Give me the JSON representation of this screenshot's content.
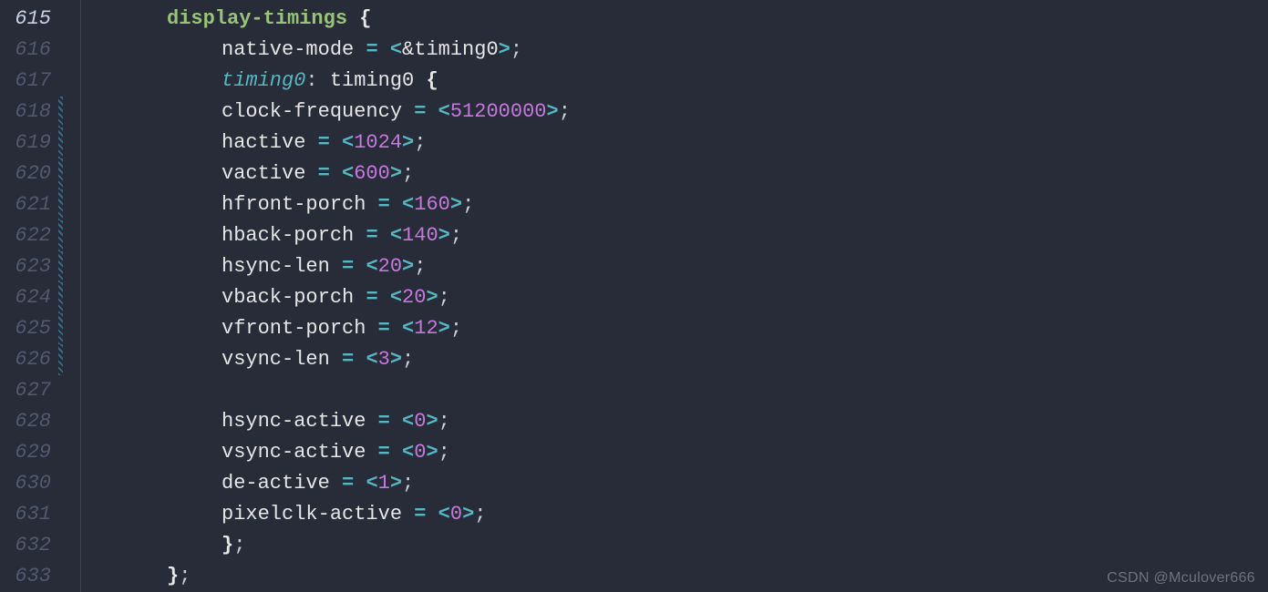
{
  "watermark": "CSDN @Mculover666",
  "gutter": {
    "start": 615,
    "active": 615,
    "modified": [
      618,
      619,
      620,
      621,
      622,
      623,
      624,
      625,
      626
    ]
  },
  "code": {
    "lines": [
      {
        "indent": 1,
        "tokens": [
          {
            "t": "display-timings",
            "c": "keyword"
          },
          {
            "t": " ",
            "c": "punct"
          },
          {
            "t": "{",
            "c": "brace"
          }
        ]
      },
      {
        "indent": 2,
        "tokens": [
          {
            "t": "native-mode",
            "c": "ident"
          },
          {
            "t": " ",
            "c": "punct"
          },
          {
            "t": "=",
            "c": "op"
          },
          {
            "t": " ",
            "c": "punct"
          },
          {
            "t": "<",
            "c": "op"
          },
          {
            "t": "&timing0",
            "c": "ref"
          },
          {
            "t": ">",
            "c": "op"
          },
          {
            "t": ";",
            "c": "punct"
          }
        ]
      },
      {
        "indent": 2,
        "tokens": [
          {
            "t": "timing0",
            "c": "label"
          },
          {
            "t": ":",
            "c": "punct"
          },
          {
            "t": " ",
            "c": "punct"
          },
          {
            "t": "timing0",
            "c": "ident"
          },
          {
            "t": " ",
            "c": "punct"
          },
          {
            "t": "{",
            "c": "brace"
          }
        ]
      },
      {
        "indent": 2,
        "tokens": [
          {
            "t": "clock-frequency",
            "c": "ident"
          },
          {
            "t": " ",
            "c": "punct"
          },
          {
            "t": "=",
            "c": "op"
          },
          {
            "t": " ",
            "c": "punct"
          },
          {
            "t": "<",
            "c": "op"
          },
          {
            "t": "51200000",
            "c": "num"
          },
          {
            "t": ">",
            "c": "op"
          },
          {
            "t": ";",
            "c": "punct"
          }
        ]
      },
      {
        "indent": 2,
        "tokens": [
          {
            "t": "hactive",
            "c": "ident"
          },
          {
            "t": " ",
            "c": "punct"
          },
          {
            "t": "=",
            "c": "op"
          },
          {
            "t": " ",
            "c": "punct"
          },
          {
            "t": "<",
            "c": "op"
          },
          {
            "t": "1024",
            "c": "num"
          },
          {
            "t": ">",
            "c": "op"
          },
          {
            "t": ";",
            "c": "punct"
          }
        ]
      },
      {
        "indent": 2,
        "tokens": [
          {
            "t": "vactive",
            "c": "ident"
          },
          {
            "t": " ",
            "c": "punct"
          },
          {
            "t": "=",
            "c": "op"
          },
          {
            "t": " ",
            "c": "punct"
          },
          {
            "t": "<",
            "c": "op"
          },
          {
            "t": "600",
            "c": "num"
          },
          {
            "t": ">",
            "c": "op"
          },
          {
            "t": ";",
            "c": "punct"
          }
        ]
      },
      {
        "indent": 2,
        "tokens": [
          {
            "t": "hfront-porch",
            "c": "ident"
          },
          {
            "t": " ",
            "c": "punct"
          },
          {
            "t": "=",
            "c": "op"
          },
          {
            "t": " ",
            "c": "punct"
          },
          {
            "t": "<",
            "c": "op"
          },
          {
            "t": "160",
            "c": "num"
          },
          {
            "t": ">",
            "c": "op"
          },
          {
            "t": ";",
            "c": "punct"
          }
        ]
      },
      {
        "indent": 2,
        "tokens": [
          {
            "t": "hback-porch",
            "c": "ident"
          },
          {
            "t": " ",
            "c": "punct"
          },
          {
            "t": "=",
            "c": "op"
          },
          {
            "t": " ",
            "c": "punct"
          },
          {
            "t": "<",
            "c": "op"
          },
          {
            "t": "140",
            "c": "num"
          },
          {
            "t": ">",
            "c": "op"
          },
          {
            "t": ";",
            "c": "punct"
          }
        ]
      },
      {
        "indent": 2,
        "tokens": [
          {
            "t": "hsync-len",
            "c": "ident"
          },
          {
            "t": " ",
            "c": "punct"
          },
          {
            "t": "=",
            "c": "op"
          },
          {
            "t": " ",
            "c": "punct"
          },
          {
            "t": "<",
            "c": "op"
          },
          {
            "t": "20",
            "c": "num"
          },
          {
            "t": ">",
            "c": "op"
          },
          {
            "t": ";",
            "c": "punct"
          }
        ]
      },
      {
        "indent": 2,
        "tokens": [
          {
            "t": "vback-porch",
            "c": "ident"
          },
          {
            "t": " ",
            "c": "punct"
          },
          {
            "t": "=",
            "c": "op"
          },
          {
            "t": " ",
            "c": "punct"
          },
          {
            "t": "<",
            "c": "op"
          },
          {
            "t": "20",
            "c": "num"
          },
          {
            "t": ">",
            "c": "op"
          },
          {
            "t": ";",
            "c": "punct"
          }
        ]
      },
      {
        "indent": 2,
        "tokens": [
          {
            "t": "vfront-porch",
            "c": "ident"
          },
          {
            "t": " ",
            "c": "punct"
          },
          {
            "t": "=",
            "c": "op"
          },
          {
            "t": " ",
            "c": "punct"
          },
          {
            "t": "<",
            "c": "op"
          },
          {
            "t": "12",
            "c": "num"
          },
          {
            "t": ">",
            "c": "op"
          },
          {
            "t": ";",
            "c": "punct"
          }
        ]
      },
      {
        "indent": 2,
        "tokens": [
          {
            "t": "vsync-len",
            "c": "ident"
          },
          {
            "t": " ",
            "c": "punct"
          },
          {
            "t": "=",
            "c": "op"
          },
          {
            "t": " ",
            "c": "punct"
          },
          {
            "t": "<",
            "c": "op"
          },
          {
            "t": "3",
            "c": "num"
          },
          {
            "t": ">",
            "c": "op"
          },
          {
            "t": ";",
            "c": "punct"
          }
        ]
      },
      {
        "indent": 2,
        "tokens": []
      },
      {
        "indent": 2,
        "tokens": [
          {
            "t": "hsync-active",
            "c": "ident"
          },
          {
            "t": " ",
            "c": "punct"
          },
          {
            "t": "=",
            "c": "op"
          },
          {
            "t": " ",
            "c": "punct"
          },
          {
            "t": "<",
            "c": "op"
          },
          {
            "t": "0",
            "c": "num"
          },
          {
            "t": ">",
            "c": "op"
          },
          {
            "t": ";",
            "c": "punct"
          }
        ]
      },
      {
        "indent": 2,
        "tokens": [
          {
            "t": "vsync-active",
            "c": "ident"
          },
          {
            "t": " ",
            "c": "punct"
          },
          {
            "t": "=",
            "c": "op"
          },
          {
            "t": " ",
            "c": "punct"
          },
          {
            "t": "<",
            "c": "op"
          },
          {
            "t": "0",
            "c": "num"
          },
          {
            "t": ">",
            "c": "op"
          },
          {
            "t": ";",
            "c": "punct"
          }
        ]
      },
      {
        "indent": 2,
        "tokens": [
          {
            "t": "de-active",
            "c": "ident"
          },
          {
            "t": " ",
            "c": "punct"
          },
          {
            "t": "=",
            "c": "op"
          },
          {
            "t": " ",
            "c": "punct"
          },
          {
            "t": "<",
            "c": "op"
          },
          {
            "t": "1",
            "c": "num"
          },
          {
            "t": ">",
            "c": "op"
          },
          {
            "t": ";",
            "c": "punct"
          }
        ]
      },
      {
        "indent": 2,
        "tokens": [
          {
            "t": "pixelclk-active",
            "c": "ident"
          },
          {
            "t": " ",
            "c": "punct"
          },
          {
            "t": "=",
            "c": "op"
          },
          {
            "t": " ",
            "c": "punct"
          },
          {
            "t": "<",
            "c": "op"
          },
          {
            "t": "0",
            "c": "num"
          },
          {
            "t": ">",
            "c": "op"
          },
          {
            "t": ";",
            "c": "punct"
          }
        ]
      },
      {
        "indent": 2,
        "tokens": [
          {
            "t": "}",
            "c": "brace"
          },
          {
            "t": ";",
            "c": "punct"
          }
        ]
      },
      {
        "indent": 1,
        "tokens": [
          {
            "t": "}",
            "c": "brace"
          },
          {
            "t": ";",
            "c": "punct"
          }
        ]
      }
    ]
  }
}
